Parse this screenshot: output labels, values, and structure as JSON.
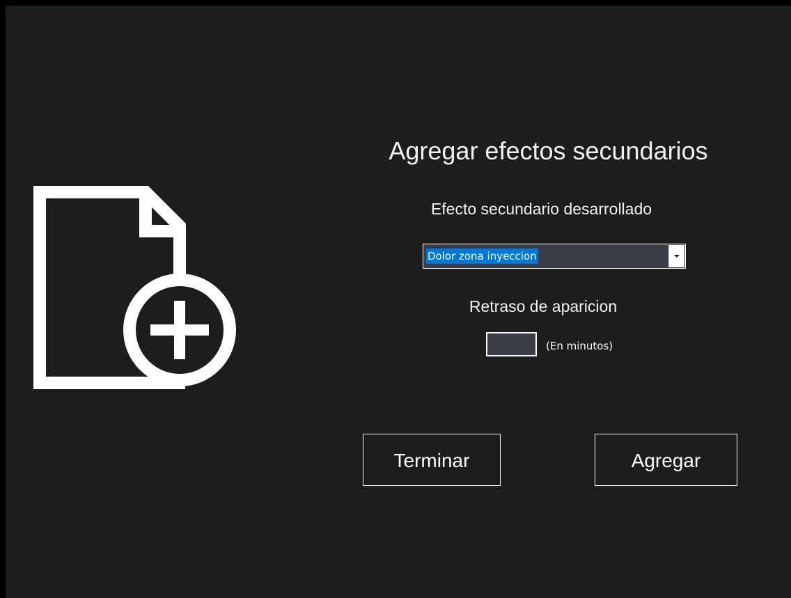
{
  "form": {
    "title": "Agregar efectos secundarios",
    "effect_label": "Efecto secundario desarrollado",
    "effect_selected": "Dolor zona inyeccion",
    "delay_label": "Retraso de aparicion",
    "delay_value": "",
    "delay_unit": "(En minutos)"
  },
  "buttons": {
    "finish_label": "Terminar",
    "add_label": "Agregar"
  },
  "icons": {
    "illustration": "document-add-icon",
    "dropdown": "chevron-down-icon"
  },
  "colors": {
    "background": "#1c1d1d",
    "field_background": "#3a3c45",
    "selection": "#0078d7",
    "foreground": "#ffffff"
  }
}
